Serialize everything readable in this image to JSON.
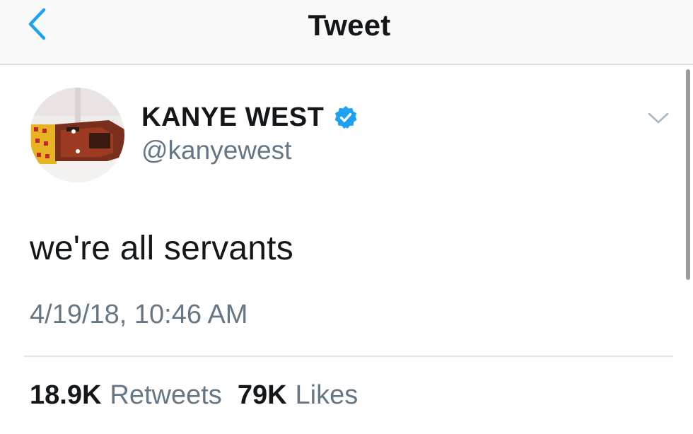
{
  "header": {
    "title": "Tweet",
    "back_icon": "chevron-left-icon",
    "accent_color": "#1da1f2"
  },
  "tweet": {
    "display_name": "KANYE WEST",
    "handle": "@kanyewest",
    "verified": true,
    "verified_icon": "verified-badge-icon",
    "menu_icon": "chevron-down-icon",
    "text": "we're all servants",
    "timestamp": "4/19/18, 10:46 AM"
  },
  "stats": {
    "retweets_count": "18.9K",
    "retweets_label": "Retweets",
    "likes_count": "79K",
    "likes_label": "Likes"
  }
}
